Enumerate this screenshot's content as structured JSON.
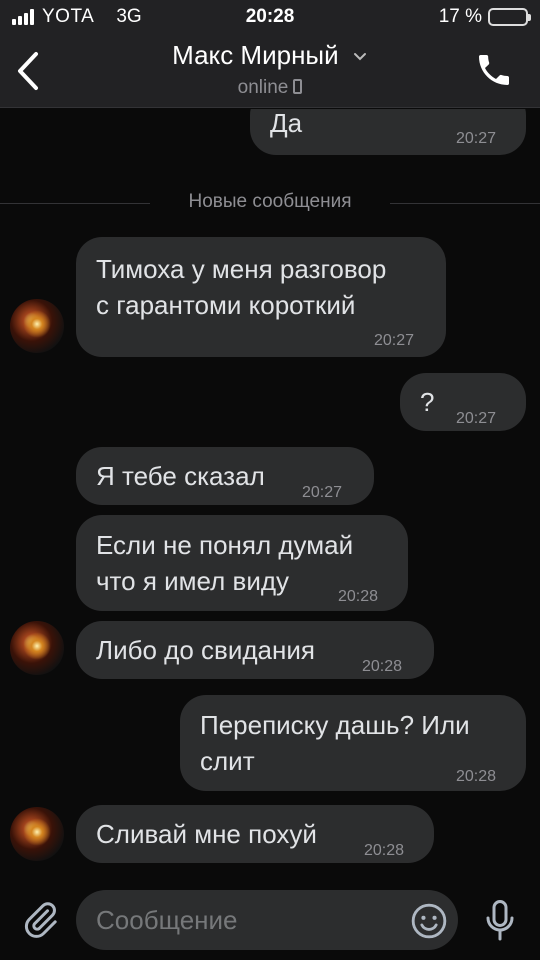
{
  "status_bar": {
    "carrier": "YOTA",
    "network": "3G",
    "time": "20:28",
    "battery": "17 %",
    "battery_level": 0.17
  },
  "header": {
    "contact_name": "Макс Мирный",
    "status": "online",
    "icons": {
      "back": "chevron-left-icon",
      "expand": "chevron-down-icon",
      "device": "mobile-device-icon",
      "call": "phone-icon"
    }
  },
  "separator": {
    "label": "Новые сообщения"
  },
  "messages": [
    {
      "dir": "out",
      "lines": [
        "Да"
      ],
      "time": "20:27"
    },
    {
      "dir": "in",
      "lines": [
        "Тимоха у меня разговор",
        "с гарантоми короткий"
      ],
      "time": "20:27",
      "avatar": true
    },
    {
      "dir": "out",
      "lines": [
        "?"
      ],
      "time": "20:27"
    },
    {
      "dir": "in",
      "lines": [
        "Я тебе сказал"
      ],
      "time": "20:27"
    },
    {
      "dir": "in",
      "lines": [
        "Если не понял думай",
        "что я имел виду"
      ],
      "time": "20:28"
    },
    {
      "dir": "in",
      "lines": [
        "Либо до свидания"
      ],
      "time": "20:28",
      "avatar": true
    },
    {
      "dir": "out",
      "lines": [
        "Переписку дашь? Или",
        "слит"
      ],
      "time": "20:28"
    },
    {
      "dir": "in",
      "lines": [
        "Сливай мне похуй"
      ],
      "time": "20:28",
      "avatar": true
    }
  ],
  "composer": {
    "placeholder": "Сообщение",
    "icons": {
      "attach": "paperclip-icon",
      "emoji": "smiley-icon",
      "mic": "microphone-icon"
    }
  },
  "colors": {
    "background": "#0a0a0a",
    "header": "#222224",
    "bubble": "#2c2d2e",
    "text": "#e1e3e6",
    "muted": "#8e8e93",
    "battery_low": "#ff3b30"
  }
}
